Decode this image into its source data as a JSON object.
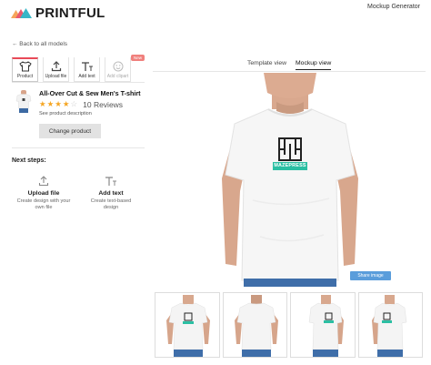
{
  "header": {
    "brand": "PRINTFUL",
    "app_title": "Mockup Generator"
  },
  "nav": {
    "back_label": "← Back to all models"
  },
  "toolbar": {
    "tabs": [
      {
        "label": "Product",
        "icon": "tshirt-icon",
        "state": "active"
      },
      {
        "label": "Upload file",
        "icon": "upload-icon",
        "state": "default"
      },
      {
        "label": "Add text",
        "icon": "text-icon",
        "state": "default"
      },
      {
        "label": "Add clipart",
        "icon": "clipart-icon",
        "state": "disabled"
      }
    ],
    "badge": "New"
  },
  "product": {
    "name": "All-Over Cut & Sew Men's T-shirt",
    "rating": 4,
    "rating_max": 5,
    "reviews_label": "10 Reviews",
    "description_link": "See product description",
    "change_button": "Change product"
  },
  "next_steps": {
    "title": "Next steps:",
    "items": [
      {
        "title": "Upload file",
        "description": "Create design with your own file",
        "icon": "upload-icon"
      },
      {
        "title": "Add text",
        "description": "Create text-based design",
        "icon": "text-icon"
      }
    ]
  },
  "views": {
    "tabs": [
      "Template view",
      "Mockup view"
    ],
    "active": "Mockup view"
  },
  "mockup": {
    "design_label": "MAZEPRESS",
    "share_button": "Share image"
  },
  "thumbnails": [
    "front",
    "back",
    "right",
    "left"
  ],
  "colors": {
    "accent": "#e94a58",
    "share": "#5a9ddb",
    "design": "#2bbfa3",
    "star": "#f5a623"
  }
}
